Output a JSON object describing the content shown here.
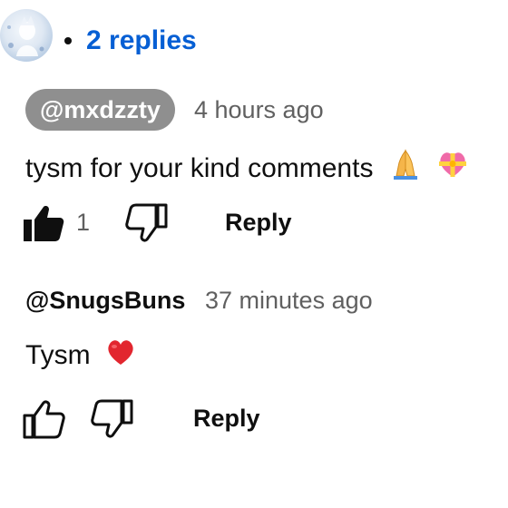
{
  "thread": {
    "replies_label": "2 replies"
  },
  "comments": [
    {
      "author": "@mxdzzty",
      "time": "4 hours ago",
      "text": "tysm for your kind comments",
      "emojis": [
        "folded-hands-emoji",
        "heart-with-ribbon-emoji"
      ],
      "like_count": "1",
      "liked": true,
      "reply_label": "Reply"
    },
    {
      "author": "@SnugsBuns",
      "time": "37 minutes ago",
      "text": "Tysm",
      "emojis": [
        "red-heart-emoji"
      ],
      "like_count": "",
      "liked": false,
      "reply_label": "Reply"
    }
  ],
  "colors": {
    "link_blue": "#065fd4",
    "author_chip_bg": "#8f8f8f",
    "secondary_text": "#606060",
    "primary_text": "#0f0f0f",
    "heart_red": "#e2262f"
  }
}
